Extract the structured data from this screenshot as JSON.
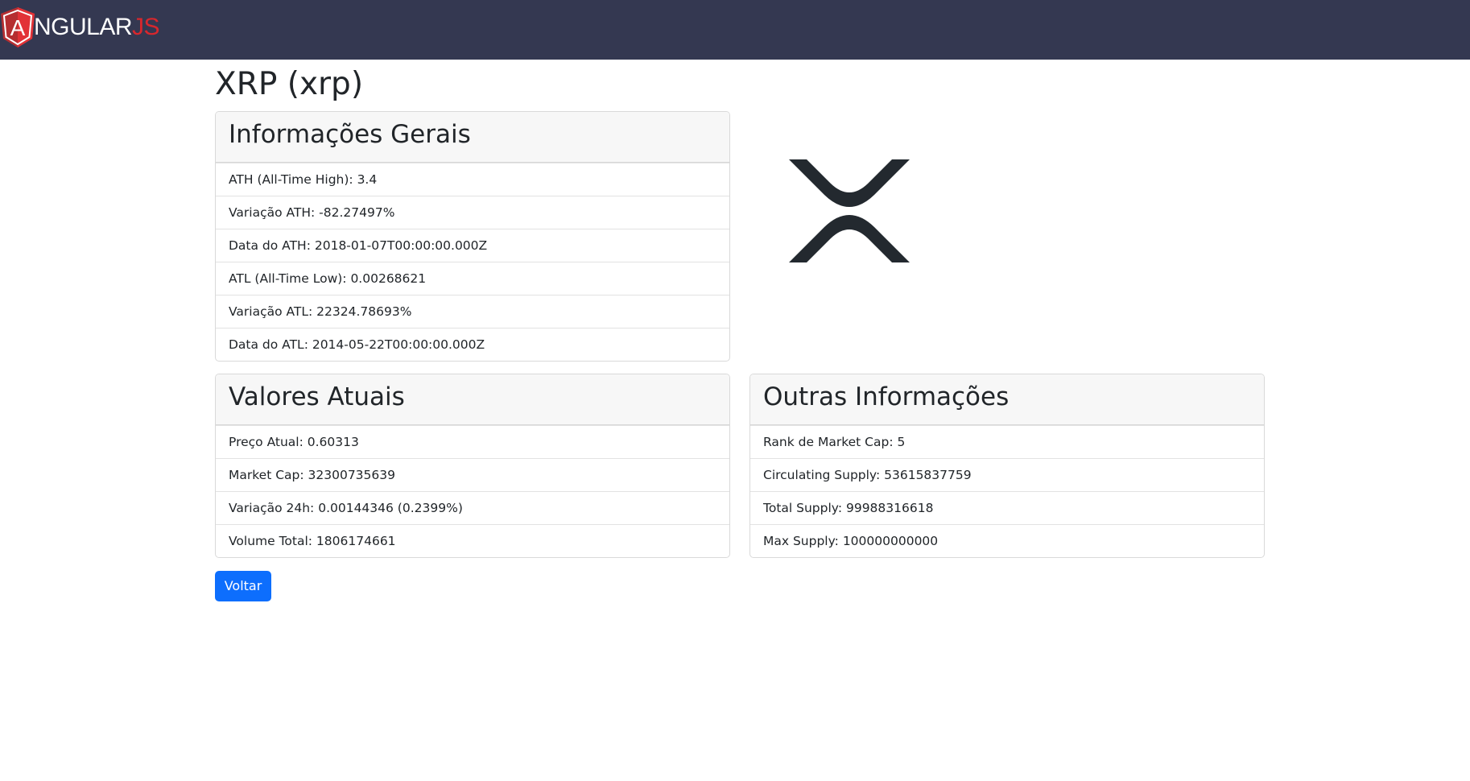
{
  "navbar": {
    "brand_main": "NGULAR",
    "brand_suffix": "JS",
    "brand_letter": "A",
    "colors": {
      "background": "#343851",
      "accent": "#d7272d"
    }
  },
  "coin": {
    "title": "XRP (xrp)",
    "logo_icon": "xrp-logo-icon"
  },
  "cards": {
    "gerais": {
      "title": "Informações Gerais",
      "rows": [
        "ATH (All-Time High): 3.4",
        "Variação ATH: -82.27497%",
        "Data do ATH: 2018-01-07T00:00:00.000Z",
        "ATL (All-Time Low): 0.00268621",
        "Variação ATL: 22324.78693%",
        "Data do ATL: 2014-05-22T00:00:00.000Z"
      ]
    },
    "atuais": {
      "title": "Valores Atuais",
      "rows": [
        "Preço Atual: 0.60313",
        "Market Cap: 32300735639",
        "Variação 24h: 0.00144346 (0.2399%)",
        "Volume Total: 1806174661"
      ]
    },
    "outras": {
      "title": "Outras Informações",
      "rows": [
        "Rank de Market Cap: 5",
        "Circulating Supply: 53615837759",
        "Total Supply: 99988316618",
        "Max Supply: 100000000000"
      ]
    }
  },
  "actions": {
    "back_label": "Voltar",
    "colors": {
      "primary": "#0d6efd"
    }
  }
}
